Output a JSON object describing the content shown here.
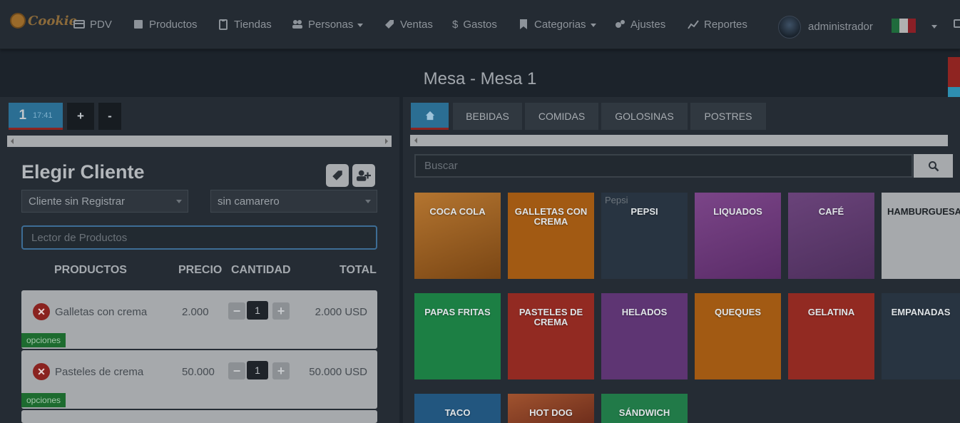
{
  "brand": {
    "name": "Cookie"
  },
  "nav": [
    {
      "label": "PDV",
      "icon": "card-icon",
      "dropdown": false
    },
    {
      "label": "Productos",
      "icon": "box-icon",
      "dropdown": false
    },
    {
      "label": "Tiendas",
      "icon": "clipboard-icon",
      "dropdown": false
    },
    {
      "label": "Personas",
      "icon": "users-icon",
      "dropdown": true
    },
    {
      "label": "Ventas",
      "icon": "tag-icon",
      "dropdown": false
    },
    {
      "label": "Gastos",
      "icon": "dollar-icon",
      "dropdown": false
    },
    {
      "label": "Categorias",
      "icon": "bookmark-icon",
      "dropdown": true
    },
    {
      "label": "Ajustes",
      "icon": "gears-icon",
      "dropdown": false
    },
    {
      "label": "Reportes",
      "icon": "chart-line-icon",
      "dropdown": false
    }
  ],
  "user": {
    "name": "administrador"
  },
  "title": "Mesa - Mesa 1",
  "order_tabs": {
    "number": "1",
    "time": "17:41",
    "add": "+",
    "remove": "-"
  },
  "category_tabs": [
    "BEBIDAS",
    "COMIDAS",
    "GOLOSINAS",
    "POSTRES"
  ],
  "client": {
    "heading": "Elegir Cliente",
    "client_select": "Cliente sin Registrar",
    "waiter_select": "sin camarero",
    "scanner_placeholder": "Lector de Productos"
  },
  "table_headers": {
    "products": "PRODUCTOS",
    "price": "PRECIO",
    "quantity": "CANTIDAD",
    "total": "TOTAL"
  },
  "order_items": [
    {
      "name": "Galletas con crema",
      "price": "2.000",
      "qty": "1",
      "total": "2.000 USD",
      "options": "opciones"
    },
    {
      "name": "Pasteles de crema",
      "price": "50.000",
      "qty": "1",
      "total": "50.000 USD",
      "options": "opciones"
    }
  ],
  "search": {
    "placeholder": "Buscar"
  },
  "products": [
    {
      "label": "COCA COLA",
      "color": "#9c6526"
    },
    {
      "label": "GALLETAS CON CREMA",
      "color": "#a25a13"
    },
    {
      "label": "PEPSI",
      "small": "Pepsi",
      "color": "#283441"
    },
    {
      "label": "LIQUADOS",
      "color": "#6d3c7b"
    },
    {
      "label": "CAFÉ",
      "color": "#5b3a6b"
    },
    {
      "label": "HAMBURGUESA",
      "color": "#a6a9ac"
    },
    {
      "label": "PAPAS FRITAS",
      "color": "#1c7f44"
    },
    {
      "label": "PASTELES DE CREMA",
      "color": "#922a22"
    },
    {
      "label": "HELADOS",
      "color": "#5e3573"
    },
    {
      "label": "QUEQUES",
      "color": "#a25a13"
    },
    {
      "label": "GELATINA",
      "color": "#922a22"
    },
    {
      "label": "EMPANADAS",
      "color": "#283441"
    },
    {
      "label": "TACO",
      "color": "#22567f"
    },
    {
      "label": "HOT DOG",
      "color": "#8a3d25"
    },
    {
      "label": "SÁNDWICH",
      "color": "#217a48"
    }
  ]
}
